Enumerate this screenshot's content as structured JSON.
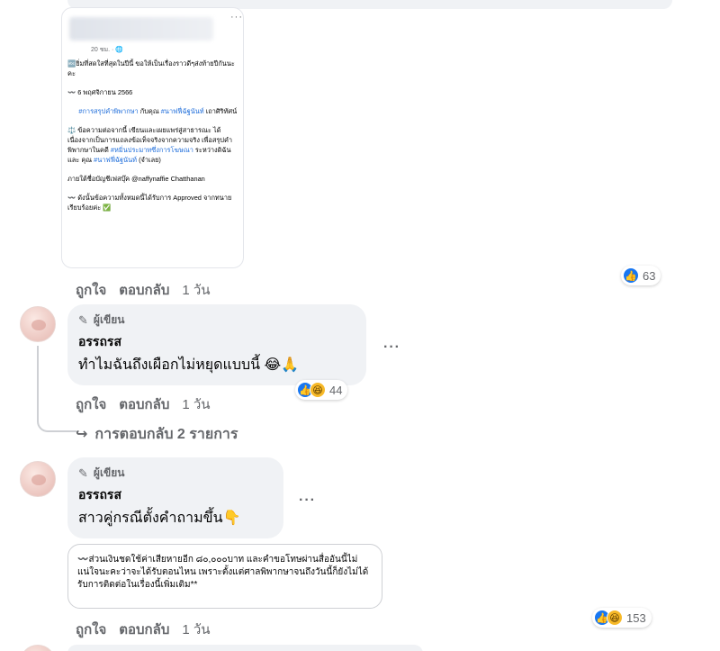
{
  "shared_post": {
    "time": "20 ชม. · 🌐",
    "more": "···",
    "paragraphs": [
      "🔤ยิ่มที่สดใสที่สุดในปีนี้ ขอให้เป็นเรื่องราวดีๆส่งท้ายปีกันนะคะ",
      "〰️ 6 พฤศจิกายน 2566",
      "#การสรุปคำพิพากษา กับคุณ #นาฟฟี่ฉัฐนันท์ เถาศิริทัศน์",
      "⚖️ ข้อความต่อจากนี้ เขียนและเผยแพร่สู่สาธารณะ ได้เนื่องจากเป็นการแถลงข้อเท็จจริงจากความจริง เพื่อสรุปคำพิพากษาในคดี #หมิ่นประมาทซึ่งการโฆษณา ระหว่างดิฉัน และ คุณ #นาฟฟี่ฉัฐนันท์ (จำเลย)",
      "ภายใต้ชื่อบัญชีเฟสบุ๊ค @naffynaffie Chatthanan",
      "〰️ ดังนั้นข้อความทั้งหมดนี้ได้รับการ Approved จากทนายเรียบร้อยค่ะ ✅"
    ],
    "link1": "#การสรุปคำพิพากษา",
    "mid1": " กับคุณ ",
    "link2": "#นาฟฟี่ฉัฐนันท์",
    "tail1": " เถาศิริทัศน์",
    "p4_pre": "⚖️ ข้อความต่อจากนี้ เขียนและเผยแพร่สู่สาธารณะ ได้เนื่องจากเป็นการแถลงข้อเท็จจริงจากความจริง เพื่อสรุปคำพิพากษาในคดี ",
    "p4_link1": "#หมิ่นประมาทซึ่งการโฆษณา",
    "p4_mid": " ระหว่างดิฉัน และ คุณ ",
    "p4_link2": "#นาฟฟี่ฉัฐนันท์",
    "p4_tail": " (จำเลย)"
  },
  "comment1": {
    "like": "ถูกใจ",
    "reply": "ตอบกลับ",
    "time": "1 วัน",
    "reaction_count": "63"
  },
  "comment2": {
    "badge": "ผู้เขียน",
    "author": "อรรถรส",
    "text": "ทำไมฉันถึงเผือกไม่หยุดแบบนี้ 😂🙏",
    "like": "ถูกใจ",
    "reply": "ตอบกลับ",
    "time": "1 วัน",
    "reaction_count": "44",
    "more": "···"
  },
  "replies_link": "การตอบกลับ 2 รายการ",
  "comment3": {
    "badge": "ผู้เขียน",
    "author": "อรรถรส",
    "text": "สาวคู่กรณีตั้งคำถามขึ้น👇",
    "more": "···",
    "quote": "〰️ส่วนเงินชดใช้ค่าเสียหายอีก ๘๐,๐๐๐บาท และคำขอโทษผ่านสื่ออันนี้ไม่แน่ใจนะคะว่าจะได้รับตอนไหน เพราะตั้งแต่ศาลพิพากษาจนถึงวันนี้ก็ยังไม่ได้รับการติดต่อในเรื่องนี้เพิ่มเติม**",
    "like": "ถูกใจ",
    "reply": "ตอบกลับ",
    "time": "1 วัน",
    "reaction_count": "153"
  },
  "colors": {
    "link": "#216fdb",
    "like_blue": "#1877f2",
    "haha_yellow": "#f7b928",
    "bubble_bg": "#f0f2f5",
    "muted_text": "#65676b"
  },
  "icons": {
    "like": "like-icon",
    "haha": "haha-icon",
    "pencil": "pencil-icon",
    "reply_arrow": "reply-arrow-icon",
    "more": "more-dots-icon",
    "globe": "globe-icon"
  }
}
